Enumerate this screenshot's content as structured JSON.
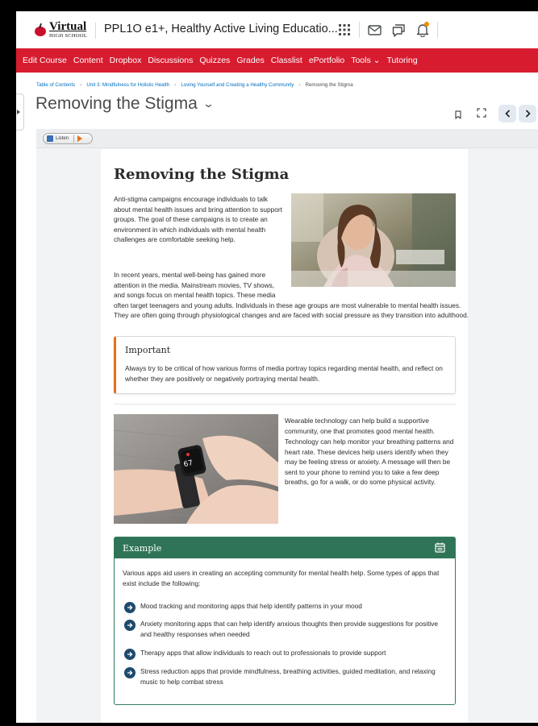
{
  "header": {
    "logo_main": "Virtual",
    "logo_sub": "HIGH SCHOOL",
    "course_title": "PPL1O e1+, Healthy Active Living Educatio...",
    "icons": [
      "grid-icon",
      "mail-icon",
      "chat-icon",
      "bell-icon"
    ]
  },
  "nav": {
    "items": [
      "Edit Course",
      "Content",
      "Dropbox",
      "Discussions",
      "Quizzes",
      "Grades",
      "Classlist",
      "ePortfolio",
      "Tools ⌄",
      "Tutoring"
    ]
  },
  "breadcrumb": {
    "items": [
      "Table of Contents",
      "Unit 3: Mindfulness for Holistic Health",
      "Loving Yourself and Creating a Healthy Community"
    ],
    "current": "Removing the Stigma"
  },
  "topic": {
    "title": "Removing the Stigma",
    "chevron": "⌄"
  },
  "listen": {
    "label": "Listen"
  },
  "article": {
    "heading": "Removing the Stigma",
    "para1": "Anti-stigma campaigns encourage individuals to talk about mental health issues and bring attention to support groups. The goal of these campaigns is to create an environment in which individuals with mental health challenges are comfortable seeking help.",
    "para2": "In recent years, mental well-being has gained more attention in the media. Mainstream movies, TV shows, and songs focus on mental health topics. These media often target teenagers and young adults. Individuals in these age groups are most vulnerable to mental health issues. They are often going through physiological changes and are faced with social pressure as they transition into adulthood.",
    "important": {
      "title": "Important",
      "text": "Always try to be critical of how various forms of media portray topics regarding mental health, and reflect on whether they are positively or negatively portraying mental health."
    },
    "para3": "Wearable technology can help build a supportive community, one that promotes good mental health.",
    "para4": "Technology can help monitor your breathing patterns and heart rate. These devices help users identify when they may be feeling stress or anxiety. A message will then be sent to your phone to remind you to take a few deep breaths, go for a walk, or do some physical activity.",
    "watch_reading": "67",
    "example": {
      "title": "Example",
      "intro": "Various apps aid users in creating an accepting community for mental health help. Some types of apps that exist include the following:",
      "items": [
        "Mood tracking and monitoring apps that help identify patterns in your mood",
        "Anxiety monitoring apps that can help identify anxious thoughts then provide suggestions for positive and healthy responses when needed",
        "Therapy apps that allow individuals to reach out to professionals to provide support",
        "Stress reduction apps that provide mindfulness, breathing activities, guided meditation, and relaxing music to help combat stress"
      ]
    }
  },
  "colors": {
    "nav_red": "#d71c2f",
    "important_accent": "#e8701a",
    "example_green": "#2f7457",
    "link_blue": "#006fbf"
  }
}
